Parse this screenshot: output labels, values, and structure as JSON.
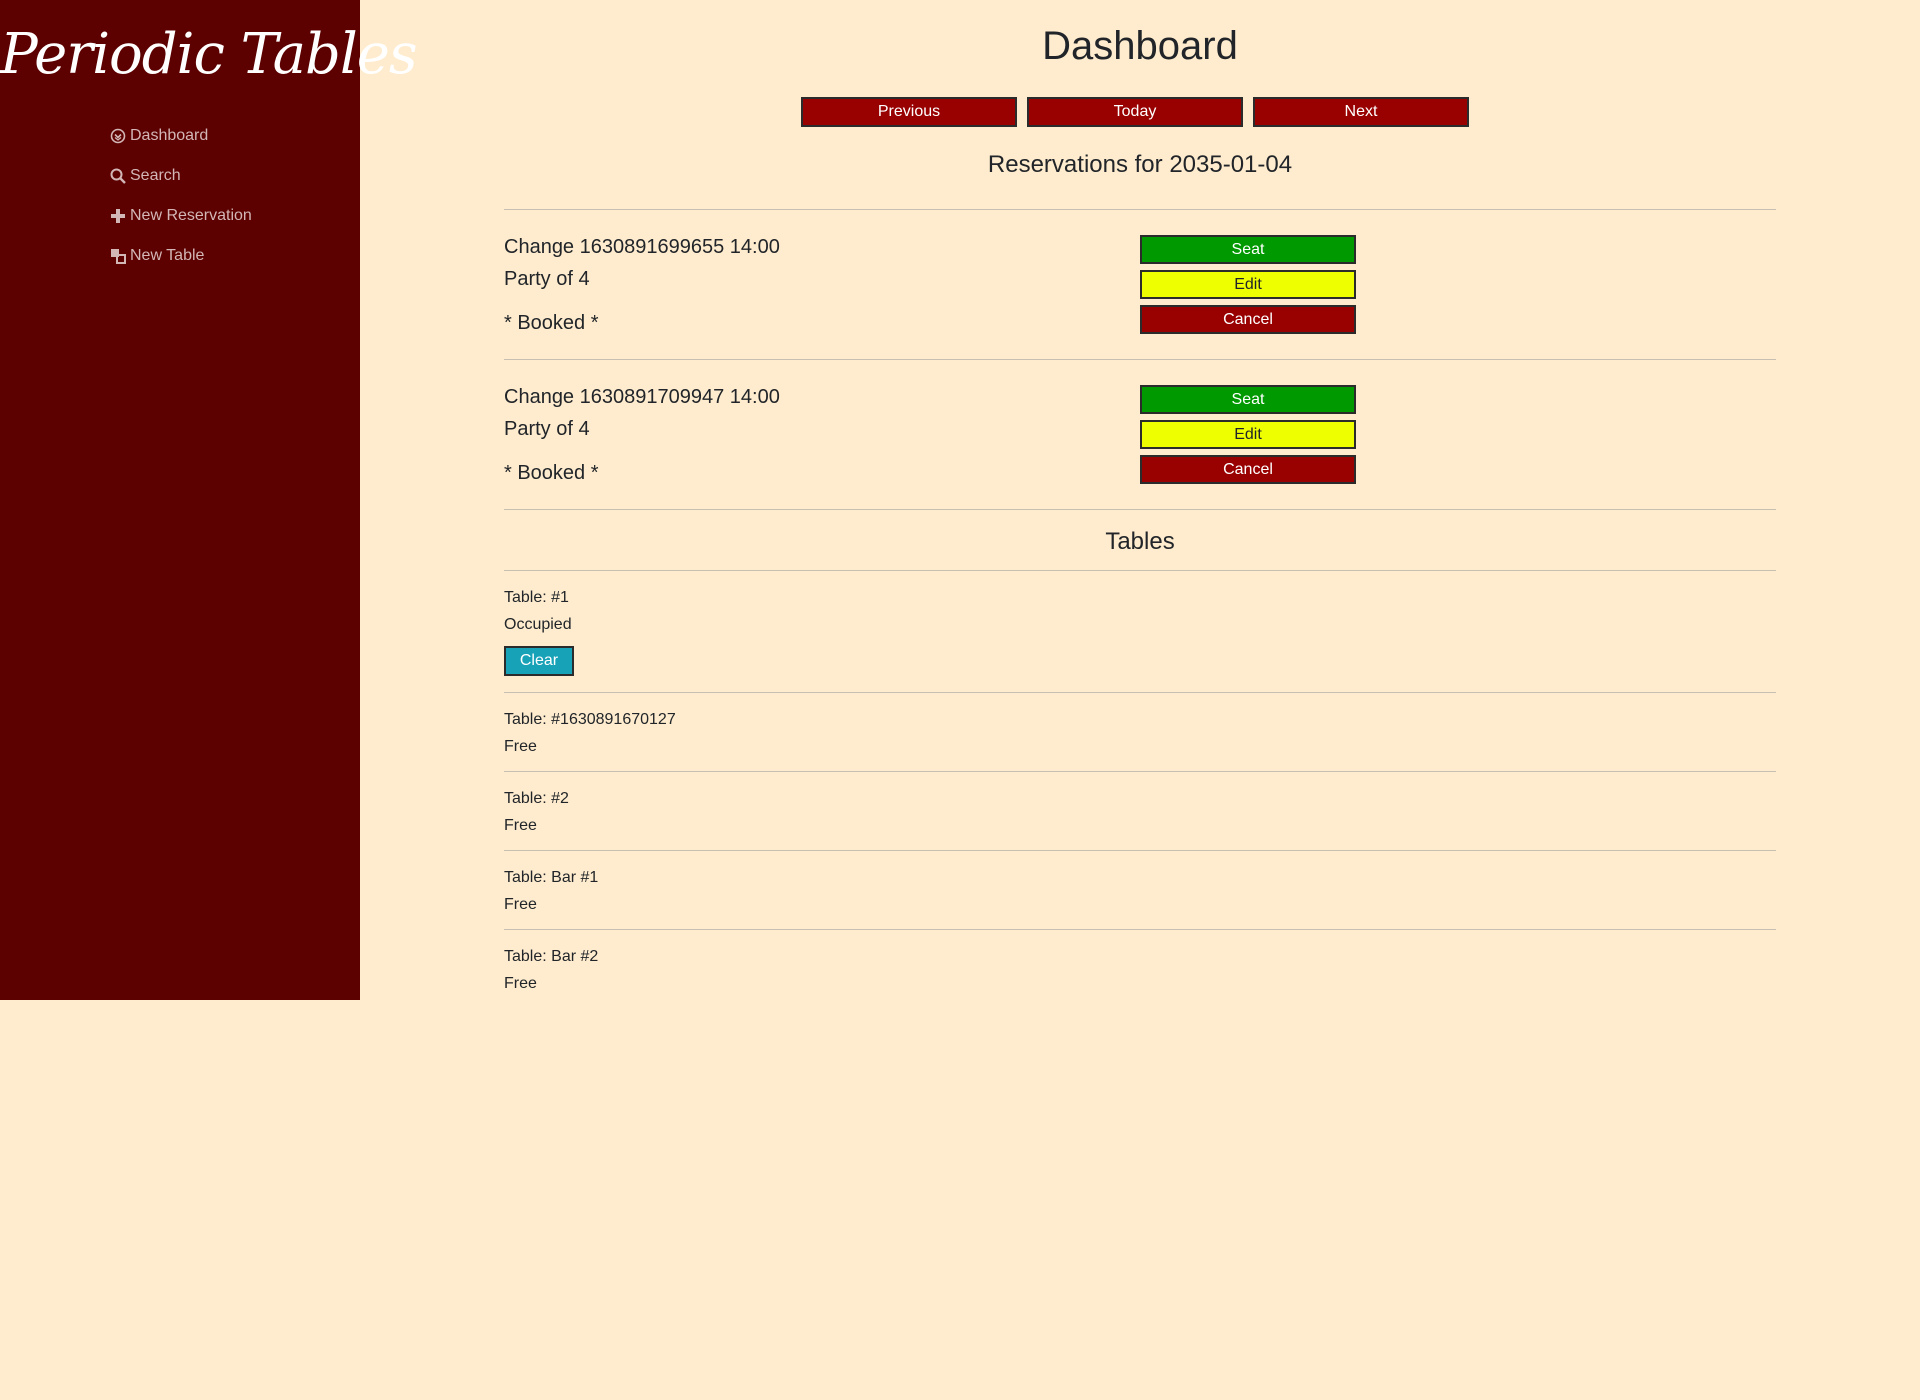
{
  "sidebar": {
    "brand": "Periodic Tables",
    "items": [
      {
        "label": "Dashboard",
        "icon": "dashboard-icon"
      },
      {
        "label": "Search",
        "icon": "search-icon"
      },
      {
        "label": "New Reservation",
        "icon": "plus-icon"
      },
      {
        "label": "New Table",
        "icon": "new-table-icon"
      }
    ]
  },
  "main": {
    "title": "Dashboard",
    "date_nav": {
      "previous": "Previous",
      "today": "Today",
      "next": "Next"
    },
    "reservations_heading": "Reservations for 2035-01-04",
    "reservations": [
      {
        "title": "Change 1630891699655 14:00",
        "party": "Party of 4",
        "status": "* Booked *",
        "actions": {
          "seat": "Seat",
          "edit": "Edit",
          "cancel": "Cancel"
        }
      },
      {
        "title": "Change 1630891709947 14:00",
        "party": "Party of 4",
        "status": "* Booked *",
        "actions": {
          "seat": "Seat",
          "edit": "Edit",
          "cancel": "Cancel"
        }
      }
    ],
    "tables_heading": "Tables",
    "tables": [
      {
        "name": "Table: #1",
        "status": "Occupied",
        "clear_label": "Clear"
      },
      {
        "name": "Table: #1630891670127",
        "status": "Free"
      },
      {
        "name": "Table: #2",
        "status": "Free"
      },
      {
        "name": "Table: Bar #1",
        "status": "Free"
      },
      {
        "name": "Table: Bar #2",
        "status": "Free"
      }
    ]
  },
  "colors": {
    "page_background": "#ffecce",
    "sidebar_background": "#5c0000",
    "nav_button": "#990000",
    "seat_button": "#009900",
    "edit_button": "#eeff00",
    "cancel_button": "#990000",
    "clear_button": "#17a2b8"
  }
}
